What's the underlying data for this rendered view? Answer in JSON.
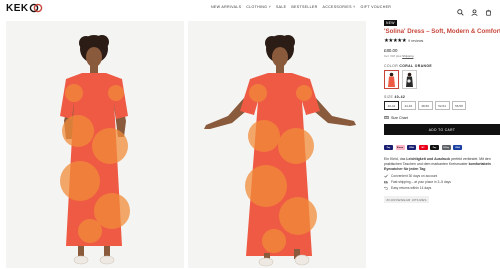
{
  "brand": {
    "logo_text": "KEK",
    "accent": "#c8453a"
  },
  "nav": [
    "NEW ARRIVALS",
    "CLOTHING ˅",
    "SALE",
    "BESTSELLER",
    "ACCESSORIES ˅",
    "GIFT VOUCHER"
  ],
  "header_icons": [
    "search-icon",
    "account-icon",
    "cart-icon"
  ],
  "product": {
    "badge": "NEW",
    "title": "'Solina' Dress – Soft, Modern & Comfortable",
    "rating_stars": "★★★★★",
    "rating_value": 5,
    "reviews": "9 reviews",
    "price": "£80.00",
    "tax_prefix": "Incl. VAT plus",
    "tax_link": "Shipping",
    "color_label": "COLOR",
    "color_value": "CORAL ORANGE",
    "size_label": "SIZE",
    "size_value": "40-42",
    "sizes": [
      "40-42",
      "44-46",
      "48-50",
      "52-54",
      "56-58"
    ],
    "size_chart": "Size Chart",
    "add_to_cart": "ADD TO CART",
    "payment_methods": [
      "Pay",
      "Klarna",
      "VISA",
      "MC",
      "Pay",
      "G Pay",
      "VISA"
    ],
    "payment_colors": [
      "#1a1f71",
      "#ffb3c7",
      "#1a1f71",
      "#eb001b",
      "#111111",
      "#5f6368",
      "#1a3fa0"
    ],
    "description_1": "Ein Kleid, das",
    "description_bold_1": "Leichtigkeit und Ausdruck",
    "description_2": "perfekt verbindet. Mit den praktischen Taschen und dem markanten Kreismuster",
    "description_bold_2": "komfortabeln Eyecatcher für jeden Tag",
    "bullets": [
      "Convenient 30 days on account",
      "Fast shipping – at your place in 3–5 days",
      "Easy returns within 14 days"
    ],
    "tag": "#CURVEWEAR UPSIZES"
  },
  "colors": {
    "dress": "#ef5a45",
    "dress_light": "#f57b5a",
    "pattern": "#f28c3a",
    "skin": "#8a5a3c",
    "hair": "#2b1d16"
  }
}
